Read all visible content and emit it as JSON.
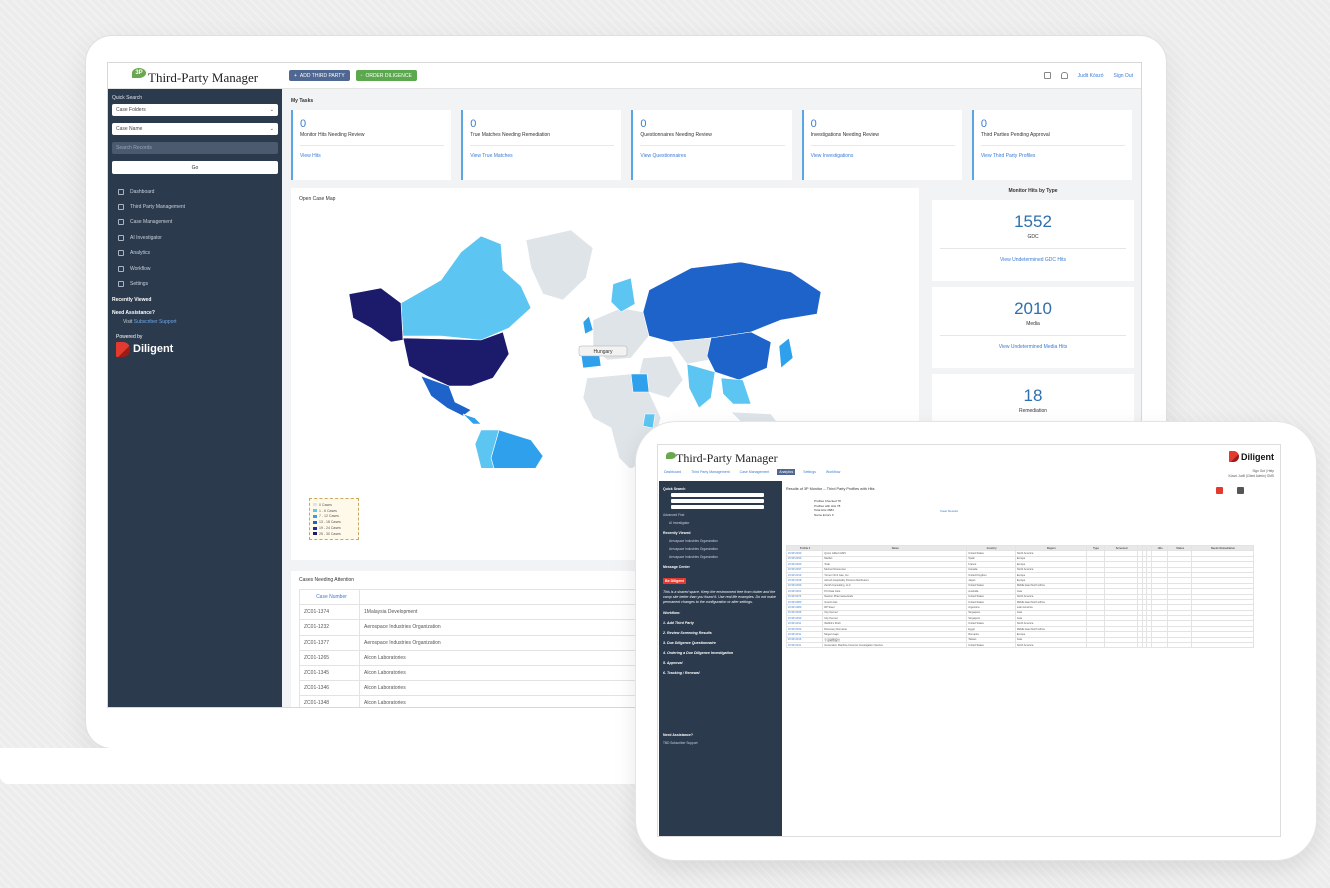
{
  "app": {
    "title": "Third-Party Manager",
    "buttons": {
      "add_third_party": "ADD THIRD PARTY",
      "order_diligence": "ORDER DILIGENCE"
    },
    "user": "Judit Kószó",
    "sign_out": "Sign Out"
  },
  "sidebar": {
    "quick_search": "Quick Search",
    "case_folders": "Case Folders",
    "case_name": "Case Name",
    "search_placeholder": "Search Records",
    "go": "Go",
    "nav": [
      {
        "label": "Dashboard",
        "icon": "home-icon"
      },
      {
        "label": "Third Party Management",
        "icon": "list-icon"
      },
      {
        "label": "Case Management",
        "icon": "pencil-icon"
      },
      {
        "label": "AI Investigator",
        "icon": "magnifier-icon"
      },
      {
        "label": "Analytics",
        "icon": "bar-chart-icon"
      },
      {
        "label": "Workflow",
        "icon": "workflow-icon"
      },
      {
        "label": "Settings",
        "icon": "gear-icon"
      }
    ],
    "recently_viewed": "Recently Viewed",
    "need_assistance": "Need Assistance?",
    "visit": "Visit",
    "subscriber_support": "Subscriber Support",
    "powered_by": "Powered by",
    "brand": "Diligent"
  },
  "tasks": {
    "title": "My Tasks",
    "cards": [
      {
        "count": "0",
        "title": "Monitor Hits Needing Review",
        "link": "View Hits"
      },
      {
        "count": "0",
        "title": "True Matches Needing Remediation",
        "link": "View True Matches"
      },
      {
        "count": "0",
        "title": "Questionnaires Needing Review",
        "link": "View Questionnaires"
      },
      {
        "count": "0",
        "title": "Investigations Needing Review",
        "link": "View Investigations"
      },
      {
        "count": "0",
        "title": "Third Parties Pending Approval",
        "link": "View Third Party Profiles"
      }
    ]
  },
  "map": {
    "title": "Open Case Map",
    "tooltip": "Hungary",
    "legend": [
      "0 Cases",
      "1 - 6 Cases",
      "7 - 12 Cases",
      "13 - 18 Cases",
      "19 - 24 Cases",
      "25 - 30 Cases"
    ],
    "colors": [
      "#dfe4e8",
      "#5cc5f2",
      "#2fa1ec",
      "#1e63c9",
      "#1b2f9a",
      "#1b1a6b"
    ]
  },
  "monitor": {
    "title": "Monitor Hits by Type",
    "stats": [
      {
        "value": "1552",
        "label": "GDC",
        "link": "View Undetermined GDC Hits"
      },
      {
        "value": "2010",
        "label": "Media",
        "link": "View Undetermined Media Hits"
      },
      {
        "value": "18",
        "label": "Remediation",
        "link": ""
      }
    ]
  },
  "cases": {
    "title": "Cases Needing Attention",
    "header": "Case Number",
    "rows": [
      [
        "ZC01-1374",
        "1Malaysia Development"
      ],
      [
        "ZC01-1232",
        "Aerospace Industries Organization"
      ],
      [
        "ZC01-1377",
        "Aerospace Industries Organization"
      ],
      [
        "ZC01-1265",
        "Alcon Laboratories"
      ],
      [
        "ZC01-1345",
        "Alcon Laboratories"
      ],
      [
        "ZC01-1346",
        "Alcon Laboratories"
      ],
      [
        "ZC01-1348",
        "Alcon Laboratories"
      ]
    ]
  },
  "tablet": {
    "title": "Third-Party Manager",
    "brand": "Diligent",
    "nav": [
      "Dashboard",
      "Third Party Management",
      "Case Management",
      "Analytics",
      "Settings",
      "Workflow"
    ],
    "user_lines": [
      "Sign Out | Help",
      "Kószó Judit (Client Admin) OMS"
    ],
    "results_title": "Results of 3P Monitor -- Third Party Profiles with Hits",
    "info": [
      "Profiles Checked 78",
      "Profiles with Hits 78",
      "Total Hits 3684",
      "Name Errors 0"
    ],
    "clear_results": "Clear Results",
    "side": {
      "quick_search": "Quick Search",
      "advanced": "Advanced Find",
      "ai": "AI Investigator",
      "recently_viewed": "Recently Viewed",
      "recent_items": [
        "Aerospace Industries Organization",
        "Aerospace Industries Organization",
        "Aerospace Industries Organization"
      ],
      "message_center": "Message Center",
      "be_diligent": "Be Diligent",
      "message": "This is a shared space. Keep the environment free from clutter and the camp site better than you found it. Use real life examples. Do not make permanent changes to the configuration or alter settings.",
      "workflow": "Workflow:",
      "steps": [
        "1. Add Third Party",
        "2. Review Screening Results",
        "3. Due Diligence Questionnaire",
        "4. Ordering a Due Diligence Investigation",
        "5. Approval",
        "6. Tracking / Renewal"
      ],
      "need_assistance": "Need Assistance?",
      "support": "TBD Subscriber Support"
    },
    "columns": [
      "Profile #",
      "Name",
      "Country",
      "Region",
      "Type",
      "Screened",
      "",
      "",
      "",
      "Hits",
      "Status",
      "Needs Remediation"
    ],
    "rows": [
      [
        "ZC3P-0030",
        "Quinn Gilbert HMV",
        "United States",
        "North America"
      ],
      [
        "ZC3P-0030",
        "Marfan",
        "Spain",
        "Europe"
      ],
      [
        "ZC3P-0030",
        "Total",
        "France",
        "Europe"
      ],
      [
        "ZC3P-0037",
        "Mezcar Resources",
        "Canada",
        "North America"
      ],
      [
        "ZC3P-0013",
        "Turner Oil & Gas, Inc.",
        "United Kingdom",
        "Europe"
      ],
      [
        "ZC3P-0158",
        "Akrosh Hospitality Fixtures Distributors",
        "Japan",
        "Europe"
      ],
      [
        "ZC3P-0030",
        "Zenith Consulting, LLC",
        "United States",
        "Middle East North Africa"
      ],
      [
        "ZC3P-0021",
        "PC Data Care",
        "Australia",
        "Asia"
      ],
      [
        "ZC3P-0074",
        "Newton Pharmaceuticals",
        "United States",
        "North America"
      ],
      [
        "ZC3P-0080",
        "Good Links",
        "United States",
        "Middle East North Africa"
      ],
      [
        "ZC3P-0080",
        "RP Steel",
        "Argentina",
        "Latin America"
      ],
      [
        "ZC3P-0036",
        "City Kennel",
        "Singapore",
        "Asia"
      ],
      [
        "ZC3P-0030",
        "City Kennel",
        "Singapore",
        "Asia"
      ],
      [
        "ZC3P-0011",
        "Webbit's Kloth",
        "United States",
        "North America"
      ],
      [
        "ZC3P-0032",
        "Discovery Romania",
        "Egypt",
        "Middle East North Africa"
      ],
      [
        "ZC3P-0011",
        "Mega Image",
        "Romania",
        "Europe"
      ],
      [
        "ZC3P-0016",
        "宇宙國際股份",
        "Taiwan",
        "Asia"
      ],
      [
        "ZC3P-0011",
        "Generation Machine Forensic Investigation Service",
        "United States",
        "North America"
      ]
    ]
  }
}
